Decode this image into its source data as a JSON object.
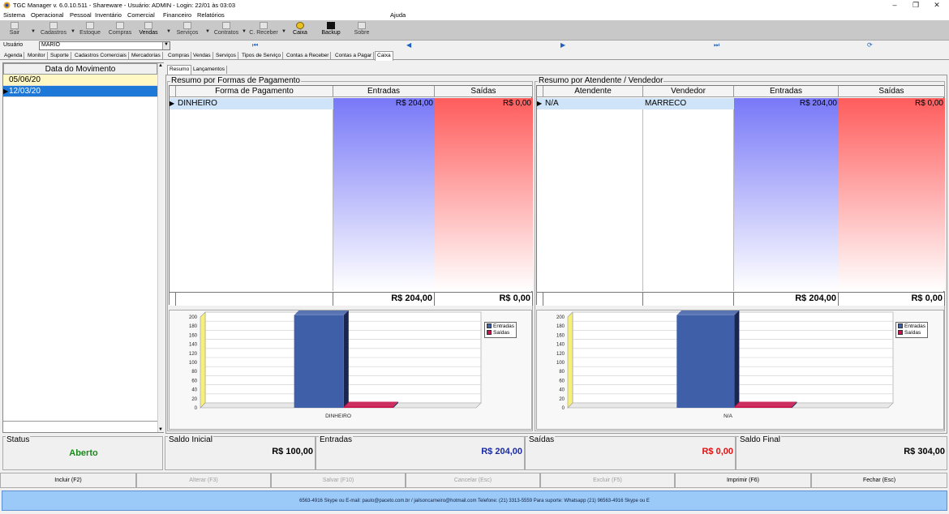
{
  "window": {
    "title": "TGC Manager v. 6.0.10.511 - Shareware - Usuário: ADMIN - Login: 22/01 às 03:03",
    "min": "–",
    "max": "❐",
    "close": "✕"
  },
  "menu": {
    "items": [
      "Sistema",
      "Operacional",
      "Pessoal",
      "Inventário",
      "Comercial",
      "Financeiro",
      "Relatórios"
    ],
    "help": "Ajuda"
  },
  "toolbar": {
    "items": [
      "Sair",
      "Cadastros",
      "Estoque",
      "Compras",
      "Vendas",
      "Serviços",
      "Contratos",
      "C. Receber",
      "Caixa",
      "Backup",
      "Sobre"
    ]
  },
  "user": {
    "label": "Usuário",
    "value": "MARIO",
    "nav": [
      "⏮",
      "◀",
      "▶",
      "⏭",
      "⟳"
    ]
  },
  "tabs": [
    "Agenda",
    "Monitor",
    "Suporte",
    "Cadastros Comerciais",
    "Mercadorias",
    "Compras",
    "Vendas",
    "Serviços",
    "Tipos de Serviço",
    "Contas a Receber",
    "Contas a Pagar",
    "Caixa"
  ],
  "subtabs": [
    "Resumo",
    "Lançamentos"
  ],
  "dates": {
    "header": "Data do Movimento",
    "rows": [
      "05/06/20",
      "12/03/20"
    ]
  },
  "pagamento": {
    "title": "Resumo por Formas de Pagamento",
    "columns": [
      "Forma de Pagamento",
      "Entradas",
      "Saídas"
    ],
    "row": [
      "DINHEIRO",
      "R$ 204,00",
      "R$ 0,00"
    ],
    "totals": [
      "R$ 204,00",
      "R$ 0,00"
    ]
  },
  "atendente": {
    "title": "Resumo por Atendente / Vendedor",
    "columns": [
      "Atendente",
      "Vendedor",
      "Entradas",
      "Saídas"
    ],
    "row": [
      "N/A",
      "MARRECO",
      "R$ 204,00",
      "R$ 0,00"
    ],
    "totals": [
      "R$ 204,00",
      "R$ 0,00"
    ]
  },
  "chart_data": [
    {
      "type": "bar",
      "categories": [
        "DINHEIRO"
      ],
      "series": [
        {
          "name": "Entradas",
          "values": [
            204
          ]
        },
        {
          "name": "Saídas",
          "values": [
            0
          ]
        }
      ],
      "ylim": [
        0,
        200
      ],
      "yticks": [
        "200",
        "180",
        "160",
        "140",
        "120",
        "100",
        "80",
        "60",
        "40",
        "20",
        "0"
      ],
      "colors": {
        "Entradas": "#3f5fa8",
        "Saídas": "#c8104a"
      }
    },
    {
      "type": "bar",
      "categories": [
        "N/A"
      ],
      "series": [
        {
          "name": "Entradas",
          "values": [
            204
          ]
        },
        {
          "name": "Saídas",
          "values": [
            0
          ]
        }
      ],
      "ylim": [
        0,
        200
      ],
      "yticks": [
        "200",
        "180",
        "160",
        "140",
        "120",
        "100",
        "80",
        "60",
        "40",
        "20",
        "0"
      ],
      "colors": {
        "Entradas": "#3f5fa8",
        "Saídas": "#c8104a"
      }
    }
  ],
  "totals": {
    "status_label": "Status",
    "status": "Aberto",
    "saldo_inicial_label": "Saldo Inicial",
    "saldo_inicial": "R$ 100,00",
    "entradas_label": "Entradas",
    "entradas": "R$ 204,00",
    "saidas_label": "Saídas",
    "saidas": "R$ 0,00",
    "saldo_final_label": "Saldo Final",
    "saldo_final": "R$ 304,00"
  },
  "buttons": [
    "Incluir (F2)",
    "Alterar (F3)",
    "Salvar (F10)",
    "Cancelar (Esc)",
    "Excluir (F5)",
    "Imprimir (F6)",
    "Fechar (Esc)"
  ],
  "status_text": "6563-4916   Skype ou E-mail: paulo@paceto.com.br / jailsoncarneiro@hotmail.com   Telefone: (21) 3313-5559   Para suporte:   Whatsapp (21) 96563-4916   Skype ou E"
}
